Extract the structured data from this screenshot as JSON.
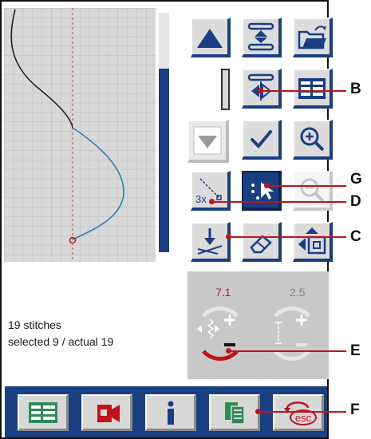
{
  "stitch_panel": {
    "stitch_count": "19 stitches",
    "selection": "selected 9 / actual 19"
  },
  "buttons": {
    "scroll_up": {
      "icon": "triangle-up-icon"
    },
    "move_position": {
      "icon": "vertical-move-icon"
    },
    "open_file": {
      "icon": "folder-open-icon"
    },
    "mirror_end_to_end": {
      "icon": "mirror-side-icon"
    },
    "stitch_list": {
      "icon": "list-icon"
    },
    "scroll_down": {
      "icon": "triangle-down-icon"
    },
    "confirm": {
      "icon": "checkmark-icon"
    },
    "zoom_in": {
      "icon": "zoom-in-icon"
    },
    "triple_stitch": {
      "icon": "triple-stitch-icon",
      "label": "3x"
    },
    "select_stitch": {
      "icon": "select-stitch-icon"
    },
    "zoom_out": {
      "icon": "zoom-out-icon"
    },
    "insert_stitch": {
      "icon": "insert-stitch-icon"
    },
    "delete_stitch": {
      "icon": "eraser-icon"
    },
    "shift_position": {
      "icon": "shift-position-icon"
    }
  },
  "adjust": {
    "left_value": "7.1",
    "right_value": "2.5"
  },
  "toolbar": {
    "items": [
      {
        "icon": "menu-list-icon"
      },
      {
        "icon": "sewing-mode-icon"
      },
      {
        "icon": "info-icon"
      },
      {
        "icon": "copy-icon"
      },
      {
        "icon": "escape-icon",
        "label": "esc"
      }
    ]
  },
  "callouts": {
    "B": "B",
    "G": "G",
    "D": "D",
    "C": "C",
    "E": "E",
    "F": "F"
  },
  "colors": {
    "accent_blue": "#1a3e82",
    "callout_red": "#c0141c",
    "panel_gray": "#c8c8c8",
    "icon_green": "#2e8b57"
  }
}
